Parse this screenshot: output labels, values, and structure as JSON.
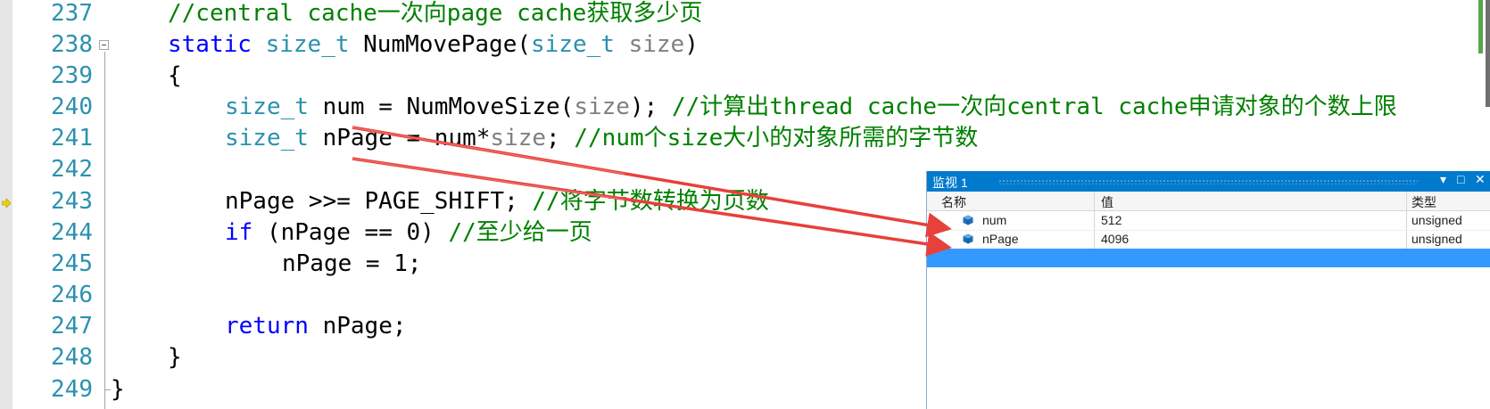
{
  "editor": {
    "line_numbers": [
      "237",
      "238",
      "239",
      "240",
      "241",
      "242",
      "243",
      "244",
      "245",
      "246",
      "247",
      "248",
      "249"
    ],
    "lines": {
      "l237": {
        "comment": "//central cache一次向page cache获取多少页"
      },
      "l238": {
        "kw": "static",
        "ty1": "size_t",
        "fn": "NumMovePage(",
        "ty2": "size_t",
        "param": "size",
        "close": ")"
      },
      "l239": {
        "text": "{"
      },
      "l240": {
        "ty": "size_t",
        "mid": "num = NumMoveSize(",
        "param": "size",
        "end": ");",
        "comment": "//计算出thread cache一次向central cache申请对象的个数上限"
      },
      "l241": {
        "ty": "size_t",
        "mid": "nPage = num*",
        "param": "size",
        "end": ";",
        "comment": "//num个size大小的对象所需的字节数"
      },
      "l243": {
        "code": "nPage >>= PAGE_SHIFT;",
        "comment": "//将字节数转换为页数"
      },
      "l244": {
        "kw": "if",
        "code": "(nPage == 0)",
        "comment": "//至少给一页"
      },
      "l245": {
        "code": "nPage = 1;"
      },
      "l247": {
        "kw": "return",
        "code": "nPage;"
      },
      "l248": {
        "text": "}"
      },
      "l249": {
        "text": "}"
      }
    }
  },
  "watch": {
    "title": "监视 1",
    "buttons": {
      "dropdown": "▾",
      "maximize": "□",
      "close": "✕"
    },
    "columns": {
      "name": "名称",
      "value": "值",
      "type": "类型"
    },
    "rows": [
      {
        "name": "num",
        "value": "512",
        "type": "unsigned"
      },
      {
        "name": "nPage",
        "value": "4096",
        "type": "unsigned"
      }
    ]
  },
  "colors": {
    "keyword": "#0000ff",
    "type": "#2b91af",
    "comment": "#008000",
    "param": "#808080",
    "accent": "#007acc",
    "selection": "#3399ff",
    "arrow": "#e8403a"
  }
}
